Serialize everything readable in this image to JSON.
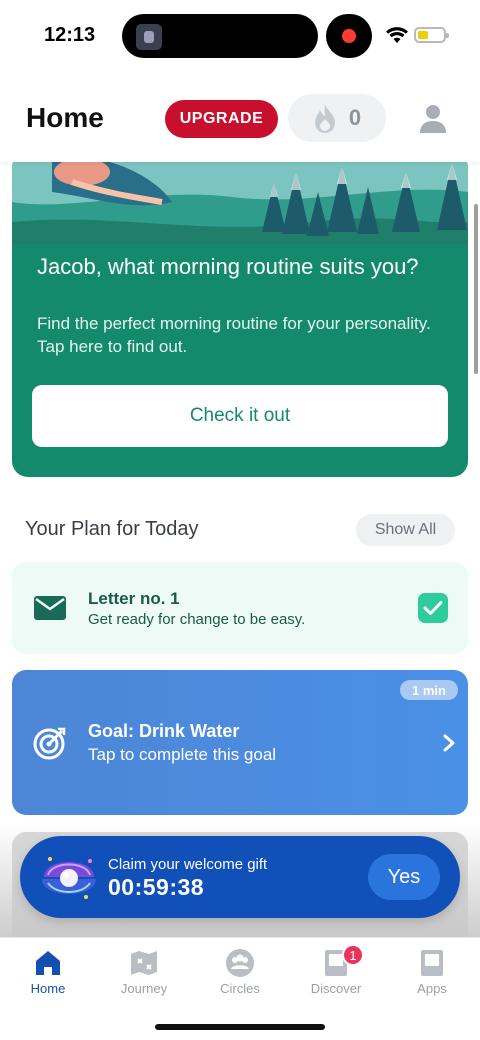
{
  "status_bar": {
    "time": "12:13"
  },
  "header": {
    "title": "Home",
    "upgrade_label": "UPGRADE",
    "streak_count": "0"
  },
  "promo": {
    "title": "Jacob, what morning routine suits you?",
    "text": "Find the perfect morning routine for your personality. Tap here to find out.",
    "button_label": "Check it out"
  },
  "plan": {
    "title": "Your Plan for Today",
    "show_all_label": "Show All",
    "items": [
      {
        "title": "Letter no. 1",
        "subtitle": "Get ready for change to be easy.",
        "icon": "mail-icon",
        "completed": true
      },
      {
        "title": "Goal: Drink Water",
        "subtitle": "Tap to complete this goal",
        "icon": "target-icon",
        "badge": "1 min"
      }
    ]
  },
  "gift_banner": {
    "label": "Claim your welcome gift",
    "timer": "00:59:38",
    "yes_label": "Yes"
  },
  "tab_bar": {
    "tabs": [
      {
        "label": "Home",
        "icon": "home-icon",
        "active": true
      },
      {
        "label": "Journey",
        "icon": "map-icon"
      },
      {
        "label": "Circles",
        "icon": "circles-icon"
      },
      {
        "label": "Discover",
        "icon": "discover-icon",
        "badge": "1"
      },
      {
        "label": "Apps",
        "icon": "apps-icon"
      }
    ]
  },
  "colors": {
    "promo_green": "#148a6d",
    "upgrade_red": "#c8102e",
    "goal_blue": "#4a90e6",
    "banner_blue": "#1150b8"
  }
}
